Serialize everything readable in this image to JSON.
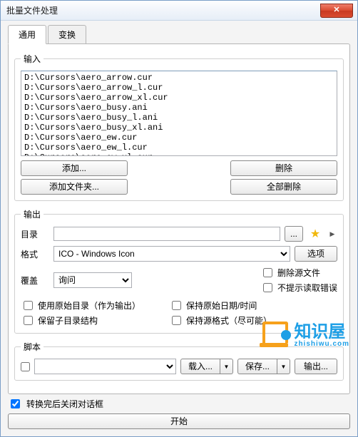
{
  "title": "批量文件处理",
  "tabs": {
    "general": "通用",
    "convert": "变换"
  },
  "input": {
    "legend": "输入",
    "files": [
      "D:\\Cursors\\aero_arrow.cur",
      "D:\\Cursors\\aero_arrow_l.cur",
      "D:\\Cursors\\aero_arrow_xl.cur",
      "D:\\Cursors\\aero_busy.ani",
      "D:\\Cursors\\aero_busy_l.ani",
      "D:\\Cursors\\aero_busy_xl.ani",
      "D:\\Cursors\\aero_ew.cur",
      "D:\\Cursors\\aero_ew_l.cur",
      "D:\\Cursors\\aero_ew_xl.cur"
    ],
    "add": "添加...",
    "addFolder": "添加文件夹...",
    "delete": "删除",
    "deleteAll": "全部删除"
  },
  "output": {
    "legend": "输出",
    "dirLabel": "目录",
    "dirValue": "",
    "browse": "...",
    "formatLabel": "格式",
    "formatValue": "ICO - Windows Icon",
    "options": "选项",
    "overwriteLabel": "覆盖",
    "overwriteValue": "询问",
    "cbDeleteSource": "删除源文件",
    "cbNoReadErr": "不提示读取错误",
    "cbUseSourceDir": "使用原始目录（作为输出）",
    "cbKeepDate": "保持原始日期/时间",
    "cbKeepSubdir": "保留子目录结构",
    "cbKeepFormat": "保持源格式（尽可能）"
  },
  "script": {
    "legend": "脚本",
    "load": "载入...",
    "save": "保存...",
    "export": "输出..."
  },
  "bottom": {
    "closeAfter": "转换完后关闭对话框",
    "start": "开始"
  },
  "watermark": {
    "main": "知识屋",
    "sub": "zhishiwu.com"
  }
}
